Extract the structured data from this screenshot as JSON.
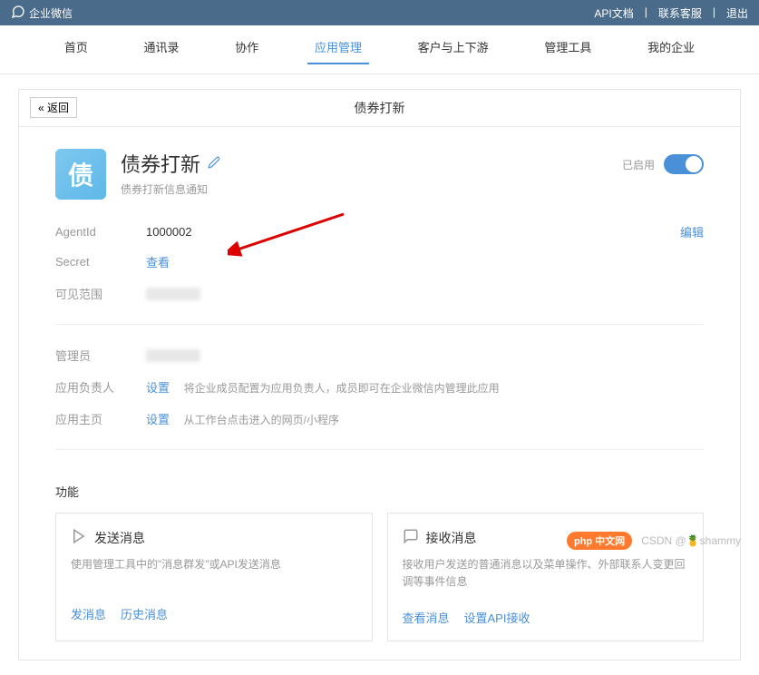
{
  "topBar": {
    "brand": "企业微信",
    "links": {
      "api": "API文档",
      "contact": "联系客服",
      "logout": "退出"
    }
  },
  "nav": {
    "items": [
      "首页",
      "通讯录",
      "协作",
      "应用管理",
      "客户与上下游",
      "管理工具",
      "我的企业"
    ],
    "activeIndex": 3
  },
  "panel": {
    "back": "« 返回",
    "title": "债券打新"
  },
  "app": {
    "iconText": "债",
    "name": "债券打新",
    "desc": "债券打新信息通知",
    "enabledLabel": "已启用"
  },
  "details": {
    "agentId": {
      "label": "AgentId",
      "value": "1000002"
    },
    "secret": {
      "label": "Secret",
      "view": "查看"
    },
    "visible": {
      "label": "可见范围"
    },
    "edit": "编辑",
    "admin": {
      "label": "管理员"
    },
    "owner": {
      "label": "应用负责人",
      "settings": "设置",
      "hint": "将企业成员配置为应用负责人，成员即可在企业微信内管理此应用"
    },
    "homepage": {
      "label": "应用主页",
      "settings": "设置",
      "hint": "从工作台点击进入的网页/小程序"
    }
  },
  "functions": {
    "title": "功能",
    "send": {
      "title": "发送消息",
      "desc": "使用管理工具中的\"消息群发\"或API发送消息",
      "actions": [
        "发消息",
        "历史消息"
      ]
    },
    "receive": {
      "title": "接收消息",
      "desc": "接收用户发送的普通消息以及菜单操作、外部联系人变更回调等事件信息",
      "actions": [
        "查看消息",
        "设置API接收"
      ]
    }
  },
  "watermark": {
    "php": "php 中文网",
    "csdn": "CSDN @🍍shammy"
  }
}
